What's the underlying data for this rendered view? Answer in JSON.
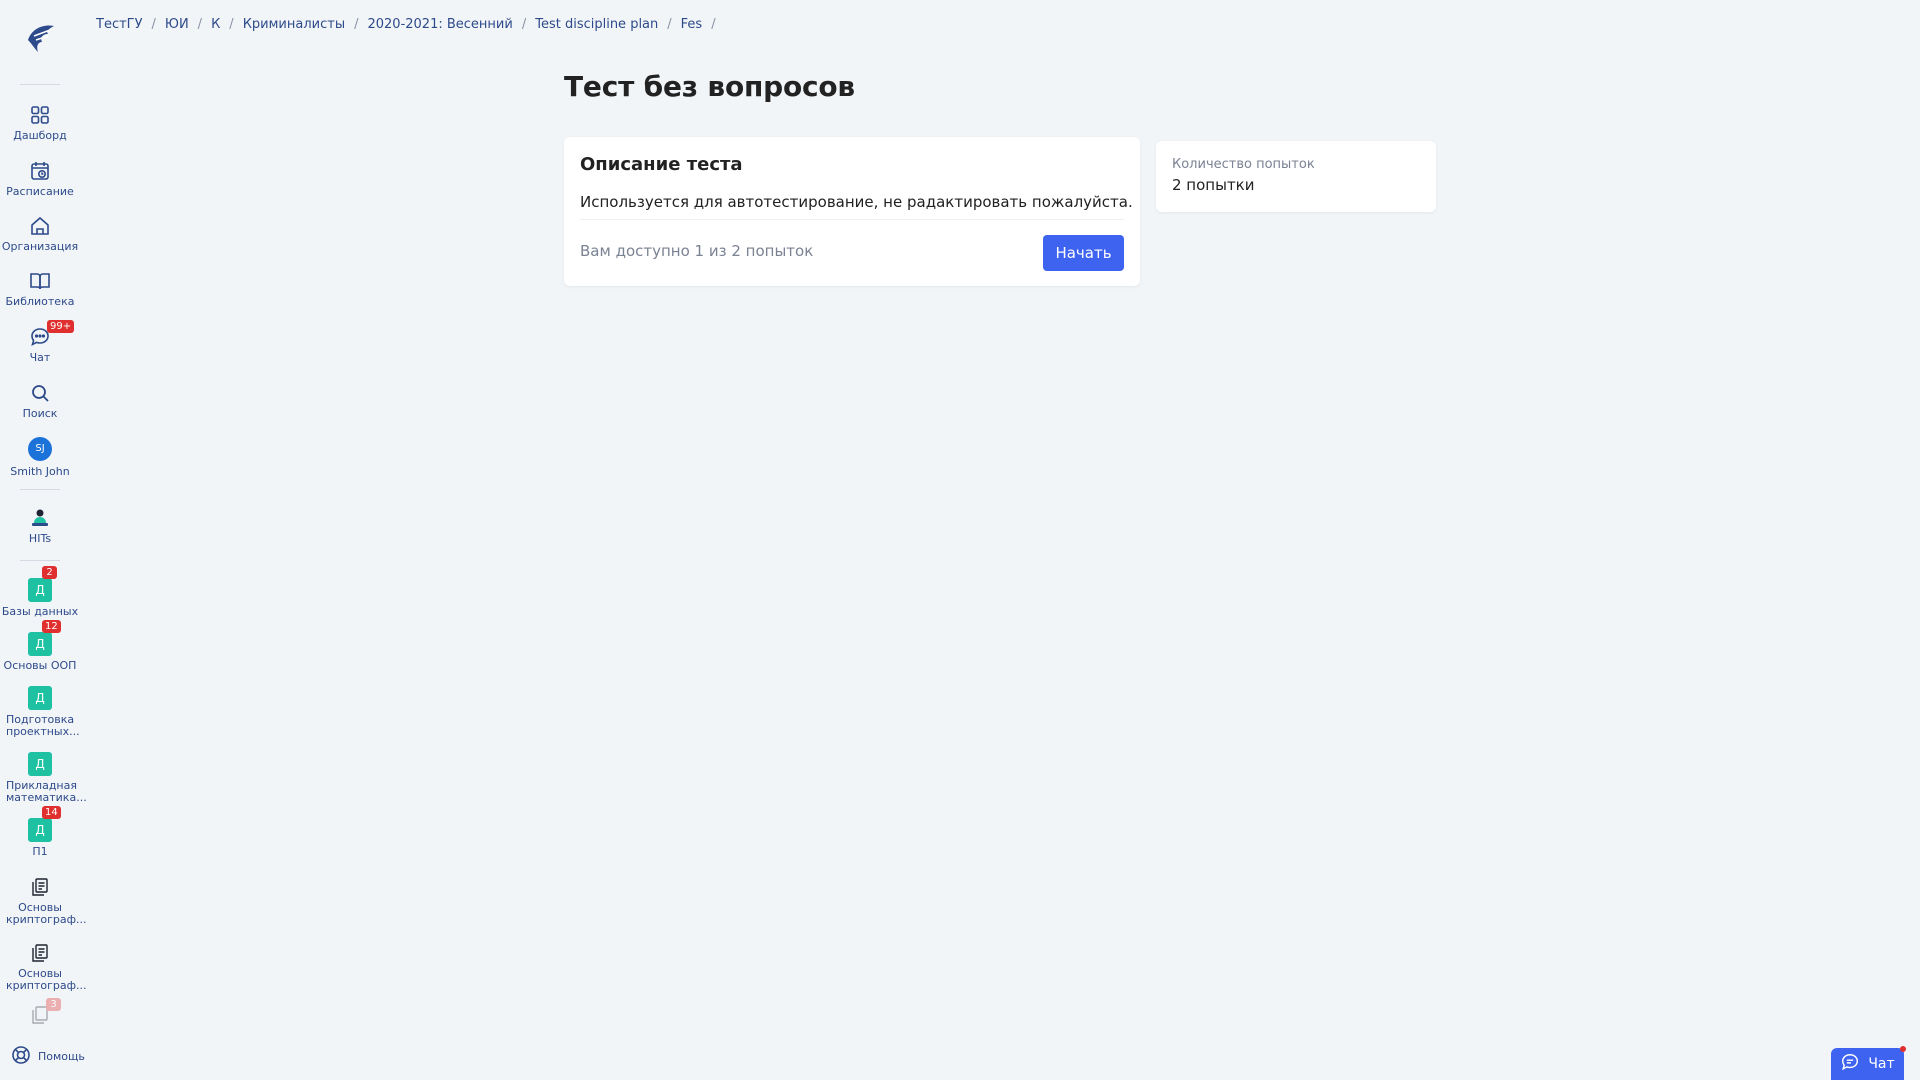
{
  "sidebar": {
    "items": [
      {
        "label": "Дашборд",
        "icon": "grid-icon"
      },
      {
        "label": "Расписание",
        "icon": "calendar-icon"
      },
      {
        "label": "Организация",
        "icon": "home-icon"
      },
      {
        "label": "Библиотека",
        "icon": "book-icon"
      },
      {
        "label": "Чат",
        "icon": "chat-icon",
        "badge": "99+"
      },
      {
        "label": "Поиск",
        "icon": "search-icon"
      }
    ],
    "user": {
      "initials": "SJ",
      "name": "Smith John"
    },
    "hits": {
      "label": "HITs"
    },
    "courses": [
      {
        "tile": "Д",
        "label": "Базы данных",
        "badge": "2"
      },
      {
        "tile": "Д",
        "label": "Основы ООП",
        "badge": "12"
      },
      {
        "tile": "Д",
        "label": "Подготовка проектных..."
      },
      {
        "tile": "Д",
        "label": "Прикладная математика..."
      },
      {
        "tile": "Д",
        "label": "П1",
        "badge": "14"
      },
      {
        "label": "Основы криптограф..."
      },
      {
        "label": "Основы криптограф..."
      },
      {
        "badge": "3"
      }
    ],
    "help": "Помощь"
  },
  "breadcrumbs": [
    "ТестГУ",
    "ЮИ",
    "К",
    "Криминалисты",
    "2020-2021: Весенний",
    "Test discipline plan",
    "Fes"
  ],
  "page": {
    "title": "Тест без вопросов"
  },
  "card": {
    "title": "Описание теста",
    "description": "Используется для автотестирование, не радактировать пожалуйста.",
    "attempts_text": "Вам доступно 1 из 2 попыток",
    "start_label": "Начать"
  },
  "side_card": {
    "label": "Количество попыток",
    "value": "2 попытки"
  },
  "chat_widget": {
    "label": "Чат"
  },
  "colors": {
    "accent": "#3d63f0",
    "badge": "#e02f2f",
    "course_tile": "#1ec2a2",
    "link": "#2d4a8a"
  }
}
